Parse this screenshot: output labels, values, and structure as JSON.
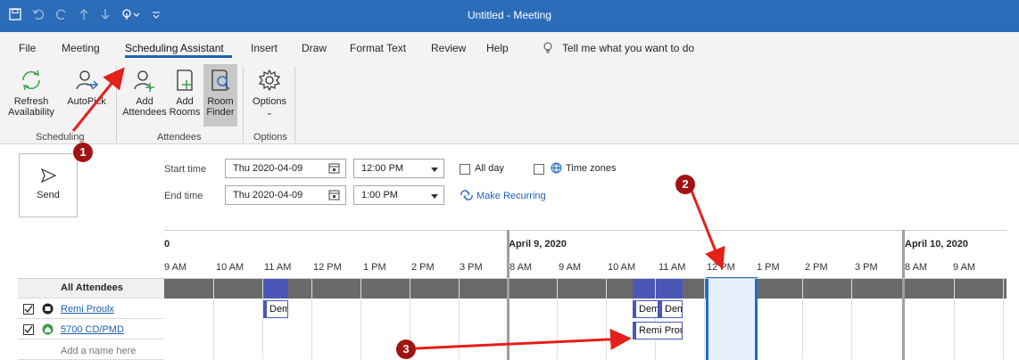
{
  "window": {
    "title": "Untitled  -  Meeting"
  },
  "tabs": [
    "File",
    "Meeting",
    "Scheduling Assistant",
    "Insert",
    "Draw",
    "Format Text",
    "Review",
    "Help"
  ],
  "tell_me": "Tell me what you want to do",
  "ribbon": {
    "refresh_l1": "Refresh",
    "refresh_l2": "Availability",
    "autopick_l1": "AutoPick",
    "add_attendees_l1": "Add",
    "add_attendees_l2": "Attendees",
    "add_rooms_l1": "Add",
    "add_rooms_l2": "Rooms",
    "room_finder_l1": "Room",
    "room_finder_l2": "Finder",
    "options": "Options",
    "group_scheduling": "Scheduling",
    "group_attendees": "Attendees",
    "group_options": "Options"
  },
  "form": {
    "send": "Send",
    "start_label": "Start time",
    "end_label": "End time",
    "start_date": "Thu 2020-04-09",
    "end_date": "Thu 2020-04-09",
    "start_time": "12:00 PM",
    "end_time": "1:00 PM",
    "all_day": "All day",
    "time_zones": "Time zones",
    "make_recurring": "Make Recurring"
  },
  "grid": {
    "prev_day_partial": "0",
    "day1": "April 9, 2020",
    "day2": "April 10, 2020",
    "hours_prev": [
      "9 AM",
      "10 AM",
      "11 AM",
      "12 PM",
      "1 PM",
      "2 PM",
      "3 PM"
    ],
    "hours_day1": [
      "8 AM",
      "9 AM",
      "10 AM",
      "11 AM",
      "12 PM",
      "1 PM",
      "2 PM",
      "3 PM"
    ],
    "hours_day2": [
      "8 AM",
      "9 AM"
    ],
    "all_attendees": "All Attendees",
    "attendee1": "Remi Proulx",
    "attendee2": "5700 CD/PMD",
    "add_name": "Add a name here",
    "appt_a": "Dem",
    "appt_b": "Dem",
    "appt_c": "Dem",
    "appt_d": "Remi Proulx"
  },
  "annotations": [
    "1",
    "2",
    "3"
  ],
  "colors": {
    "accent": "#2b6cb8",
    "busy": "#4b57b5",
    "annotation": "#a01313"
  }
}
